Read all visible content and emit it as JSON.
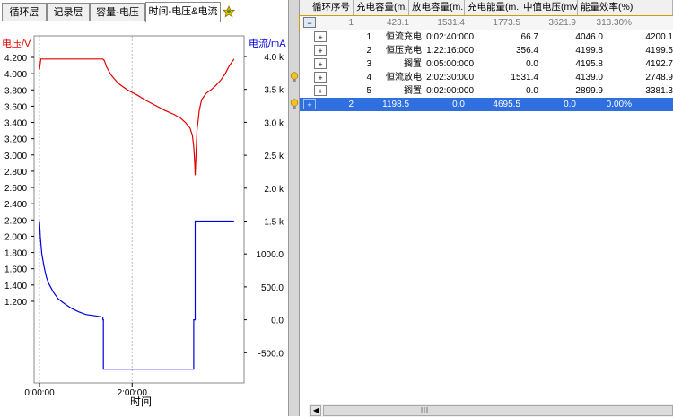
{
  "tabs": [
    {
      "label": "循环层",
      "active": false
    },
    {
      "label": "记录层",
      "active": false
    },
    {
      "label": "容量-电压",
      "active": false
    },
    {
      "label": "时间-电压&电流",
      "active": true
    }
  ],
  "colors": {
    "voltage": "#e00000",
    "current": "#0000e0",
    "selection": "#2f6fe0"
  },
  "chart_data": {
    "type": "line",
    "xlabel": "时间",
    "x_ticks": [
      "0:00:00",
      "2:00:00"
    ],
    "left_axis": {
      "label": "电压/V",
      "ticks": [
        "4.200",
        "4.000",
        "3.800",
        "3.600",
        "3.400",
        "3.200",
        "3.000",
        "2.800",
        "2.600",
        "2.400",
        "2.200",
        "2.000",
        "1.800",
        "1.600",
        "1.400",
        "1.200"
      ],
      "range": [
        1.1,
        4.25
      ]
    },
    "right_axis": {
      "label": "电流/mA",
      "ticks": [
        "4.0 k",
        "3.5 k",
        "3.0 k",
        "2.5 k",
        "2.0 k",
        "1.5 k",
        "1000.0",
        "500.0",
        "0.0",
        "-500.0"
      ],
      "range": [
        -750,
        4050
      ]
    },
    "x_range_hours": [
      0,
      4.3
    ],
    "grid": "vertical-dashed",
    "series": [
      {
        "name": "电压",
        "axis": "left",
        "color": "#e00000",
        "x": [
          0.0,
          0.03,
          0.05,
          0.2,
          1.0,
          1.37,
          1.4,
          1.45,
          1.55,
          1.7,
          1.9,
          2.1,
          2.3,
          2.5,
          2.7,
          2.9,
          3.05,
          3.15,
          3.25,
          3.3,
          3.33,
          3.35,
          3.36,
          3.4,
          3.45,
          3.5,
          3.6,
          3.7,
          3.8,
          3.9,
          4.0,
          4.1,
          4.2
        ],
        "y": [
          4.05,
          4.18,
          4.18,
          4.18,
          4.18,
          4.18,
          4.16,
          4.08,
          3.98,
          3.88,
          3.8,
          3.74,
          3.67,
          3.61,
          3.55,
          3.5,
          3.45,
          3.4,
          3.33,
          3.24,
          3.1,
          2.9,
          2.75,
          3.3,
          3.55,
          3.68,
          3.76,
          3.8,
          3.85,
          3.91,
          3.99,
          4.1,
          4.18
        ]
      },
      {
        "name": "电流",
        "axis": "right",
        "color": "#0000e0",
        "x": [
          0.0,
          0.02,
          0.05,
          0.1,
          0.15,
          0.2,
          0.3,
          0.4,
          0.55,
          0.7,
          0.85,
          1.0,
          1.2,
          1.37,
          1.37,
          1.38,
          1.38,
          3.33,
          3.33,
          3.36,
          3.36,
          4.2
        ],
        "y": [
          1500,
          1250,
          1000,
          800,
          650,
          550,
          420,
          320,
          240,
          170,
          120,
          80,
          60,
          40,
          0,
          0,
          -750,
          -750,
          0,
          0,
          1500,
          1500
        ]
      }
    ]
  },
  "table": {
    "columns": [
      "循环序号",
      "充电容量(m...",
      "放电容量(m...",
      "充电能量(m...",
      "中值电压(mV)",
      "能量效率(%)"
    ],
    "rows": [
      {
        "type": "cycle",
        "expander": "−",
        "name": "",
        "idx": "1",
        "cap": "423.1",
        "dcap": "1531.4",
        "energy": "1773.5",
        "vmid": "3621.9",
        "eff": "313.30%",
        "extra": "",
        "style": "sel1",
        "bulb": false
      },
      {
        "type": "step",
        "expander": "+",
        "idx": "1",
        "name": "恒流充电",
        "time": "0:02:40:000",
        "a": "66.7",
        "b": "4046.0",
        "c": "4200.1",
        "bulb": false
      },
      {
        "type": "step",
        "expander": "+",
        "idx": "2",
        "name": "恒压充电",
        "time": "1:22:16:000",
        "a": "356.4",
        "b": "4199.8",
        "c": "4199.5",
        "bulb": false
      },
      {
        "type": "step",
        "expander": "+",
        "idx": "3",
        "name": "搁置",
        "time": "0:05:00:000",
        "a": "0.0",
        "b": "4195.8",
        "c": "4192.7",
        "bulb": false
      },
      {
        "type": "step",
        "expander": "+",
        "idx": "4",
        "name": "恒流放电",
        "time": "2:02:30:000",
        "a": "1531.4",
        "b": "4139.0",
        "c": "2748.9",
        "bulb": true
      },
      {
        "type": "step",
        "expander": "+",
        "idx": "5",
        "name": "搁置",
        "time": "0:02:00:000",
        "a": "0.0",
        "b": "2899.9",
        "c": "3381.3",
        "bulb": false
      },
      {
        "type": "cycle",
        "expander": "+",
        "name": "",
        "idx": "2",
        "cap": "1198.5",
        "dcap": "0.0",
        "energy": "4695.5",
        "vmid": "0.0",
        "eff": "0.00%",
        "style": "sel2",
        "bulb": true
      }
    ]
  }
}
